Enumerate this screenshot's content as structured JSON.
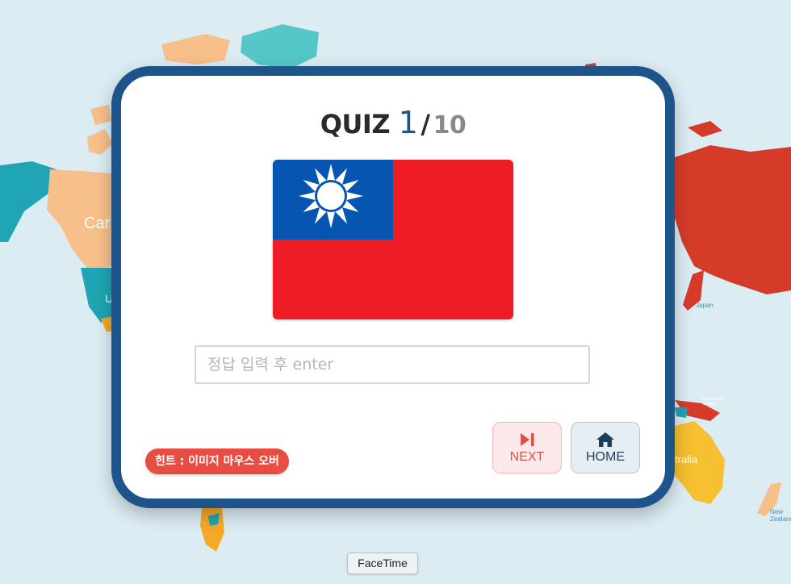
{
  "quiz": {
    "title_prefix": "QUIZ",
    "current": "1",
    "separator": "/",
    "total": "10"
  },
  "flag": {
    "country_hidden": true,
    "colors": {
      "field": "#ee1c25",
      "canton": "#0555b1",
      "sun": "#ffffff"
    }
  },
  "answer_input": {
    "placeholder": "정답 입력 후 enter",
    "value": ""
  },
  "hint": {
    "label": "힌트 : 이미지 마우스 오버"
  },
  "buttons": {
    "next": {
      "label": "NEXT",
      "icon": "skip-next-icon"
    },
    "home": {
      "label": "HOME",
      "icon": "home-icon"
    }
  },
  "background_map": {
    "labels": {
      "canada": "Car",
      "usa": "U",
      "japan": "Japan",
      "australia": "tralia",
      "new_zealand": "New Zealand",
      "png": "Papua New Guinea"
    }
  },
  "dock_tooltip": {
    "label": "FaceTime"
  },
  "theme": {
    "card_border": "#1d5489",
    "accent_red": "#e84d43",
    "background": "#dcecf3"
  }
}
